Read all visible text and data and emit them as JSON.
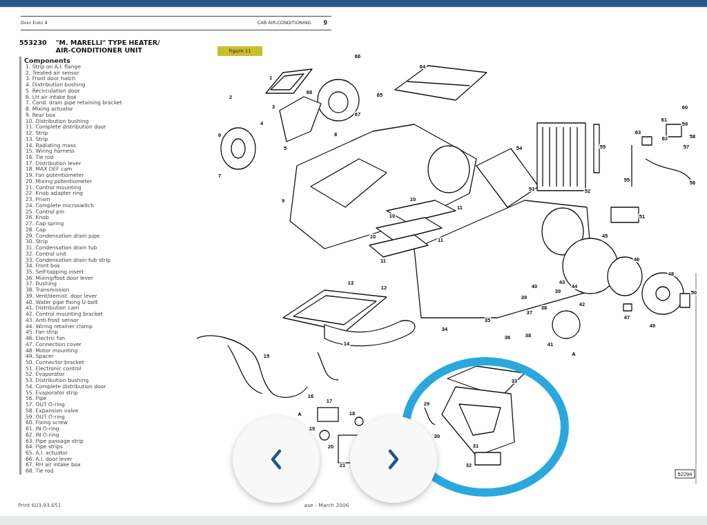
{
  "header": {
    "manual": "Daily Euro 4",
    "section": "CAB AIR-CONDITIONING",
    "page": "9"
  },
  "title": {
    "code": "553230",
    "lines": [
      "\"M. MARELLI\" TYPE HEATER/",
      "AIR-CONDITIONER UNIT"
    ]
  },
  "components": {
    "heading": "Components",
    "items": [
      "1. Strip on A.I. flange",
      "2. Treated air sensor",
      "3. Front door hatch",
      "4. Distribution bushing",
      "5. Recirculation door",
      "6. LH air intake box",
      "7. Cond. drain pipe retaining bracket",
      "8. Mixing actuator",
      "9. Rear box",
      "10. Distribution bushing",
      "11. Complete distribution door",
      "12. Strip",
      "13. Strip",
      "14. Radiating mass",
      "15. Wiring harness",
      "16. Tie rod",
      "17. Distribution lever",
      "18. MAX DEF cam",
      "19. Fan potentiometer",
      "20. Mixing potentiometer",
      "21. Control mounting",
      "22. Knob adapter ring",
      "23. Prism",
      "24. Complete microswitch",
      "25. Control pin",
      "26. Knob",
      "27. Cap spring",
      "28. Cap",
      "29. Condensation drain pipe",
      "30. Strip",
      "31. Condensation drain tub",
      "32. Control unit",
      "33. Condensation drain tub strip",
      "34. Front box",
      "35. Self-tapping insert",
      "36. Mixing/foot door lever",
      "37. Bushing",
      "38. Transmission",
      "39. Vent/demist. door lever",
      "40. Water pipe fixing U-bolt",
      "41. Distribution cam",
      "42. Control mounting bracket",
      "43. Anti-frost sensor",
      "44. Wiring retainer clamp",
      "45. Fan strip",
      "46. Electric fan",
      "47. Connection cover",
      "48. Motor mounting",
      "49. Spacer",
      "50. Connector bracket",
      "51. Electronic control",
      "52. Evaporator",
      "53. Distribution bushing",
      "54. Complete distribution door",
      "55. Evaporator strip",
      "56. Pipe",
      "57. OUT O-ring",
      "58. Expansion valve",
      "59. OUT O-ring",
      "60. Fixing screw",
      "61. IN O-ring",
      "62. IN O-ring",
      "63. Pipe passage strip",
      "64. Pipe strips",
      "65. A.I. actuator",
      "66. A.I. door lever",
      "67. RH air intake box",
      "68. Tie rod"
    ]
  },
  "figure": {
    "label": "Figure 11",
    "code": "52294",
    "callouts": [
      "1",
      "2",
      "3",
      "4",
      "5",
      "6",
      "7",
      "8",
      "9",
      "66",
      "65",
      "67",
      "68",
      "64",
      "54",
      "53",
      "52",
      "55",
      "55",
      "56",
      "63",
      "61",
      "60",
      "59",
      "62",
      "58",
      "57",
      "51",
      "45",
      "46",
      "48",
      "50",
      "47",
      "49",
      "44",
      "43",
      "42",
      "40",
      "39",
      "39",
      "38",
      "37",
      "38",
      "36",
      "41",
      "A",
      "10",
      "10",
      "10",
      "11",
      "11",
      "11",
      "12",
      "13",
      "14",
      "35",
      "34",
      "15",
      "16",
      "17",
      "18",
      "19",
      "20",
      "21",
      "A",
      "33",
      "29",
      "30",
      "31",
      "32"
    ]
  },
  "footer": {
    "print": "Print 603.93.651",
    "edition": "ase - March 2006"
  },
  "viewer": {
    "buttons": [
      {
        "kind": "previous"
      },
      {
        "kind": "next"
      }
    ]
  }
}
